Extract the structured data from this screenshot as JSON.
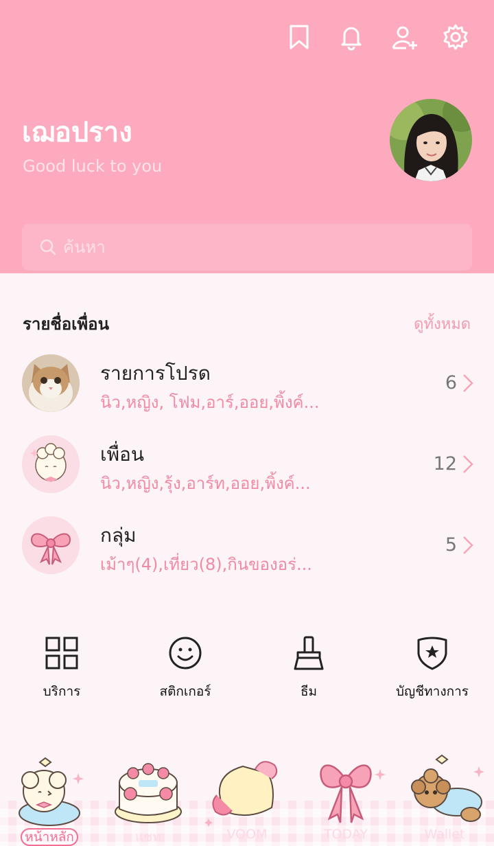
{
  "header": {
    "icons": [
      "bookmark-icon",
      "bell-icon",
      "add-friend-icon",
      "gear-icon"
    ],
    "profile": {
      "name": "เฌอปราง",
      "status": "Good luck to you"
    },
    "search": {
      "placeholder": "ค้นหา"
    }
  },
  "friends": {
    "title": "รายชื่อเพื่อน",
    "see_all": "ดูทั้งหมด",
    "rows": [
      {
        "title": "รายการโปรด",
        "sub": "นิว,หญิง, โฟม,อาร์,ออย,พิ้งค์...",
        "count": "6"
      },
      {
        "title": "เพื่อน",
        "sub": "นิว,หญิง,รุ้ง,อาร์ท,ออย,พิ้งค์...",
        "count": "12"
      },
      {
        "title": "กลุ่ม",
        "sub": "เม้าๆ(4),เที่ยว(8),กินของอร่...",
        "count": "5"
      }
    ]
  },
  "menu": [
    {
      "label": "บริการ",
      "icon": "grid-icon"
    },
    {
      "label": "สติกเกอร์",
      "icon": "smile-icon"
    },
    {
      "label": "ธีม",
      "icon": "brush-icon"
    },
    {
      "label": "บัญชีทางการ",
      "icon": "shield-star-icon"
    }
  ],
  "tabs": [
    {
      "label": "หน้าหลัก",
      "active": true
    },
    {
      "label": "แชท"
    },
    {
      "label": "VOOM"
    },
    {
      "label": "TODAY"
    },
    {
      "label": "Wallet"
    }
  ],
  "colors": {
    "header_bg": "#feaabe",
    "accent": "#f08aa5",
    "page_bg": "#fdf4f7"
  }
}
